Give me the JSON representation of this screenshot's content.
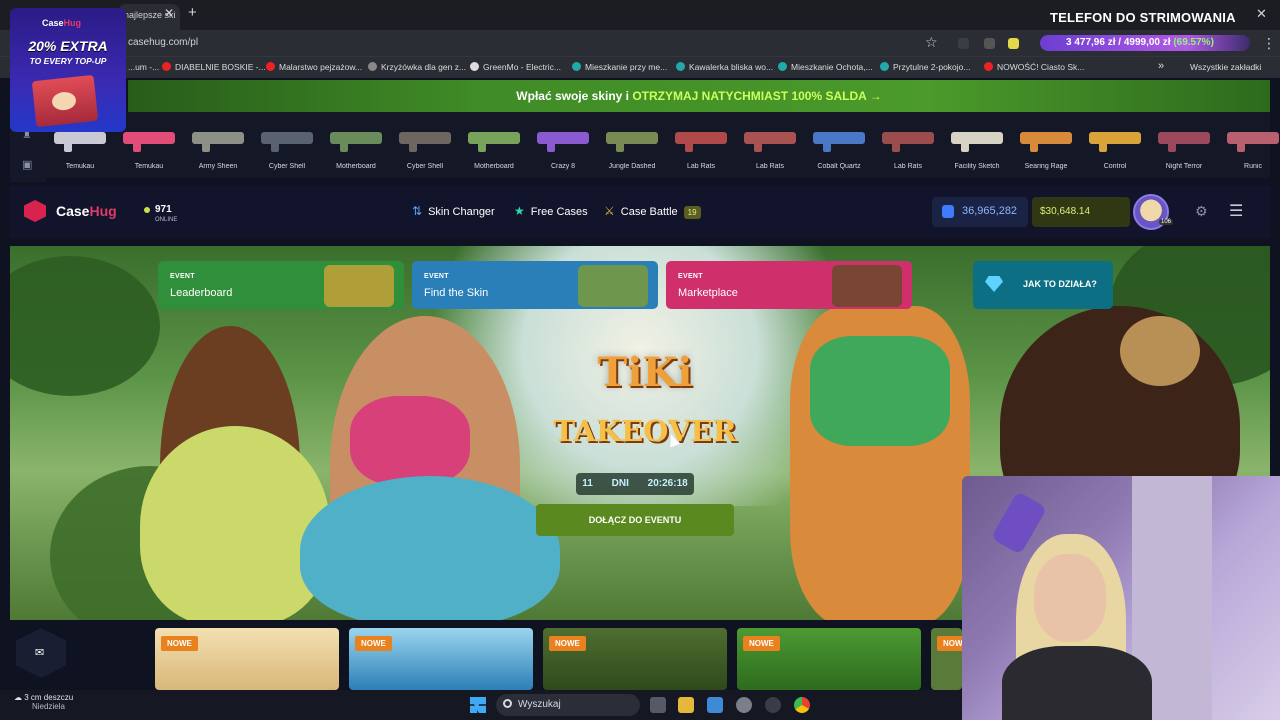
{
  "browser": {
    "tab_title": "najlepsze ski",
    "url": "casehug.com/pl",
    "stream_title": "TELEFON DO STRIMOWANIA",
    "goal": {
      "current": "3 477,96 zł",
      "target": "4999,00 zł",
      "percent": "(69.57%)",
      "progress": 0.6957
    },
    "bookmarks": [
      "...um -...",
      "DIABELNIE BOSKIE -...",
      "Malarstwo pejzażow...",
      "Krzyżówka dla gen z...",
      "GreenMo - Electric...",
      "Mieszkanie przy me...",
      "Kawalerka bliska wo...",
      "Mieszkanie Ochota,...",
      "Przytulne 2-pokojo...",
      "NOWOŚĆ! Ciasto Sk..."
    ],
    "bookmarks_all": "Wszystkie zakładki"
  },
  "promo": {
    "logo_a": "Case",
    "logo_b": "Hug",
    "headline": "20% EXTRA",
    "sub": "TO EVERY TOP-UP"
  },
  "banner": {
    "text": "Wpłać swoje skiny i ",
    "highlight": "OTRZYMAJ NATYCHMIAST 100% SALDA →"
  },
  "live_drops": [
    {
      "name": "Temukau",
      "color": "#c9c9d6"
    },
    {
      "name": "Temukau",
      "color": "#e24c79"
    },
    {
      "name": "Army Sheen",
      "color": "#8e8f86"
    },
    {
      "name": "Cyber Shell",
      "color": "#5a6170"
    },
    {
      "name": "Motherboard",
      "color": "#6a8c5a"
    },
    {
      "name": "Cyber Shell",
      "color": "#6d6760"
    },
    {
      "name": "Motherboard",
      "color": "#77a35a"
    },
    {
      "name": "Crazy 8",
      "color": "#8a5ad1"
    },
    {
      "name": "Jungle Dashed",
      "color": "#7a8a55"
    },
    {
      "name": "Lab Rats",
      "color": "#b04a4a"
    },
    {
      "name": "Lab Rats",
      "color": "#a85252"
    },
    {
      "name": "Cobalt Quartz",
      "color": "#4a77c8"
    },
    {
      "name": "Lab Rats",
      "color": "#9b4d4d"
    },
    {
      "name": "Facility Sketch",
      "color": "#d6d2c4"
    },
    {
      "name": "Searing Rage",
      "color": "#d68a3a"
    },
    {
      "name": "Control",
      "color": "#d9a33a"
    },
    {
      "name": "Night Terror",
      "color": "#9a4a5a"
    },
    {
      "name": "Runic",
      "color": "#b86070"
    }
  ],
  "header": {
    "logo_a": "Case",
    "logo_b": "Hug",
    "online_count": "971",
    "online_label": "ONLINE",
    "nav": {
      "skin_changer": "Skin Changer",
      "free_cases": "Free Cases",
      "case_battle": "Case Battle",
      "case_battle_badge": "19"
    },
    "balance_coins": "36,965,282",
    "balance_usd": "$30,648.14",
    "plus": "+",
    "level": "106"
  },
  "events": [
    {
      "tag": "EVENT",
      "name": "Leaderboard",
      "color": "#2f8f3a",
      "art": "#c7a23a"
    },
    {
      "tag": "EVENT",
      "name": "Find the Skin",
      "color": "#2b7fb8",
      "art": "#7a9a3a"
    },
    {
      "tag": "EVENT",
      "name": "Marketplace",
      "color": "#cf2f6a",
      "art": "#6b4a2a"
    }
  ],
  "howto": "JAK TO DZIAŁA?",
  "hero": {
    "title_a": "TiKi",
    "title_b": "TAKEOVER",
    "days": "11 DNI",
    "time": "20:26:18",
    "join": "DOŁĄCZ DO EVENTU"
  },
  "new_cases": [
    {
      "tag": "NOWE",
      "color": "#e6c98a"
    },
    {
      "tag": "NOWE",
      "color": "#3aa5d6"
    },
    {
      "tag": "NOWE",
      "color": "#4b6a2e"
    },
    {
      "tag": "NOWE",
      "color": "#3f8c2c"
    },
    {
      "tag": "NOWE",
      "color": "#5a7a3a"
    }
  ],
  "taskbar": {
    "weather_a": "3 cm deszczu",
    "weather_b": "Niedziela",
    "search": "Wyszukaj"
  }
}
